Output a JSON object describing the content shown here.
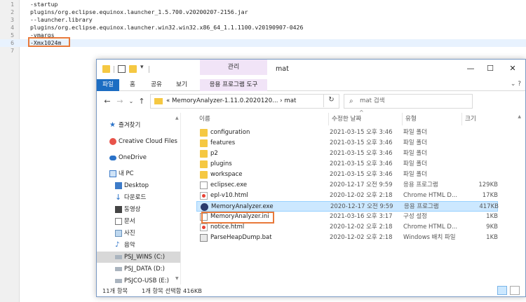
{
  "editor": {
    "lines": [
      {
        "num": "1",
        "text": "-startup"
      },
      {
        "num": "2",
        "text": "plugins/org.eclipse.equinox.launcher_1.5.700.v20200207-2156.jar"
      },
      {
        "num": "3",
        "text": "--launcher.library"
      },
      {
        "num": "4",
        "text": "plugins/org.eclipse.equinox.launcher.win32.win32.x86_64_1.1.1100.v20190907-0426"
      },
      {
        "num": "5",
        "text": "-vmargs"
      },
      {
        "num": "6",
        "text": "-Xmx1024m"
      },
      {
        "num": "7",
        "text": ""
      }
    ],
    "highlight_color": "#e8793a"
  },
  "explorer": {
    "title": "mat",
    "context_tab": "관리",
    "ribbon_tabs": [
      "파일",
      "홈",
      "공유",
      "보기",
      "응용 프로그램 도구"
    ],
    "address": {
      "path": "«  MemoryAnalyzer-1.11.0.2020120...  ›  mat",
      "search_placeholder": "mat 검색"
    },
    "columns": {
      "name": "이름",
      "date": "수정한 날짜",
      "type": "유형",
      "size": "크기"
    },
    "files": [
      {
        "name": "configuration",
        "date": "2021-03-15 오후 3:46",
        "type": "파일 폴더",
        "size": "",
        "icon": "folder-icon"
      },
      {
        "name": "features",
        "date": "2021-03-15 오후 3:46",
        "type": "파일 폴더",
        "size": "",
        "icon": "folder-icon"
      },
      {
        "name": "p2",
        "date": "2021-03-15 오후 3:46",
        "type": "파일 폴더",
        "size": "",
        "icon": "folder-icon"
      },
      {
        "name": "plugins",
        "date": "2021-03-15 오후 3:46",
        "type": "파일 폴더",
        "size": "",
        "icon": "folder-icon"
      },
      {
        "name": "workspace",
        "date": "2021-03-15 오후 3:46",
        "type": "파일 폴더",
        "size": "",
        "icon": "folder-icon"
      },
      {
        "name": "eclipsec.exe",
        "date": "2020-12-17 오전 9:59",
        "type": "응용 프로그램",
        "size": "129KB",
        "icon": "file-icon"
      },
      {
        "name": "epl-v10.html",
        "date": "2020-12-02 오후 2:18",
        "type": "Chrome HTML D...",
        "size": "17KB",
        "icon": "html-icon"
      },
      {
        "name": "MemoryAnalyzer.exe",
        "date": "2020-12-17 오전 9:59",
        "type": "응용 프로그램",
        "size": "417KB",
        "icon": "exe-icon"
      },
      {
        "name": "MemoryAnalyzer.ini",
        "date": "2021-03-16 오후 3:17",
        "type": "구성 설정",
        "size": "1KB",
        "icon": "ini-icon"
      },
      {
        "name": "notice.html",
        "date": "2020-12-02 오후 2:18",
        "type": "Chrome HTML D...",
        "size": "9KB",
        "icon": "html-icon"
      },
      {
        "name": "ParseHeapDump.bat",
        "date": "2020-12-02 오후 2:18",
        "type": "Windows 배치 파일",
        "size": "1KB",
        "icon": "bat-icon"
      }
    ],
    "nav": [
      {
        "label": "즐겨찾기",
        "icon": "star-icon"
      },
      {
        "label": "Creative Cloud Files",
        "icon": "cloud-icon"
      },
      {
        "label": "OneDrive",
        "icon": "cloud-icon"
      },
      {
        "label": "내 PC",
        "icon": "pc-icon"
      },
      {
        "label": "Desktop",
        "icon": "desktop-icon"
      },
      {
        "label": "다운로드",
        "icon": "download-icon"
      },
      {
        "label": "동영상",
        "icon": "video-icon"
      },
      {
        "label": "문서",
        "icon": "document-icon"
      },
      {
        "label": "사진",
        "icon": "picture-icon"
      },
      {
        "label": "음악",
        "icon": "music-icon"
      },
      {
        "label": "PSJ_WINS (C:)",
        "icon": "drive-icon"
      },
      {
        "label": "PSJ_DATA (D:)",
        "icon": "drive-icon"
      },
      {
        "label": "PSJCO-USB (E:)",
        "icon": "drive-icon"
      }
    ],
    "status": {
      "count": "11개 항목",
      "selection": "1개 항목 선택함 416KB"
    },
    "colors": {
      "accent": "#1c6dc2",
      "selection": "#cce8ff",
      "context": "#f1e4f7"
    }
  }
}
